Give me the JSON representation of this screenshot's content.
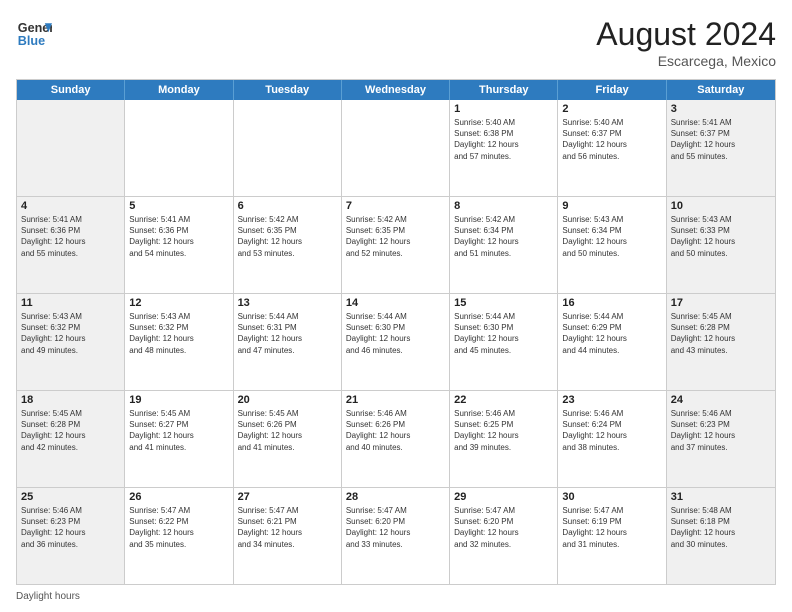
{
  "header": {
    "logo_line1": "General",
    "logo_line2": "Blue",
    "month_year": "August 2024",
    "location": "Escarcega, Mexico"
  },
  "days_of_week": [
    "Sunday",
    "Monday",
    "Tuesday",
    "Wednesday",
    "Thursday",
    "Friday",
    "Saturday"
  ],
  "weeks": [
    [
      {
        "day": "",
        "info": ""
      },
      {
        "day": "",
        "info": ""
      },
      {
        "day": "",
        "info": ""
      },
      {
        "day": "",
        "info": ""
      },
      {
        "day": "1",
        "info": "Sunrise: 5:40 AM\nSunset: 6:38 PM\nDaylight: 12 hours\nand 57 minutes."
      },
      {
        "day": "2",
        "info": "Sunrise: 5:40 AM\nSunset: 6:37 PM\nDaylight: 12 hours\nand 56 minutes."
      },
      {
        "day": "3",
        "info": "Sunrise: 5:41 AM\nSunset: 6:37 PM\nDaylight: 12 hours\nand 55 minutes."
      }
    ],
    [
      {
        "day": "4",
        "info": "Sunrise: 5:41 AM\nSunset: 6:36 PM\nDaylight: 12 hours\nand 55 minutes."
      },
      {
        "day": "5",
        "info": "Sunrise: 5:41 AM\nSunset: 6:36 PM\nDaylight: 12 hours\nand 54 minutes."
      },
      {
        "day": "6",
        "info": "Sunrise: 5:42 AM\nSunset: 6:35 PM\nDaylight: 12 hours\nand 53 minutes."
      },
      {
        "day": "7",
        "info": "Sunrise: 5:42 AM\nSunset: 6:35 PM\nDaylight: 12 hours\nand 52 minutes."
      },
      {
        "day": "8",
        "info": "Sunrise: 5:42 AM\nSunset: 6:34 PM\nDaylight: 12 hours\nand 51 minutes."
      },
      {
        "day": "9",
        "info": "Sunrise: 5:43 AM\nSunset: 6:34 PM\nDaylight: 12 hours\nand 50 minutes."
      },
      {
        "day": "10",
        "info": "Sunrise: 5:43 AM\nSunset: 6:33 PM\nDaylight: 12 hours\nand 50 minutes."
      }
    ],
    [
      {
        "day": "11",
        "info": "Sunrise: 5:43 AM\nSunset: 6:32 PM\nDaylight: 12 hours\nand 49 minutes."
      },
      {
        "day": "12",
        "info": "Sunrise: 5:43 AM\nSunset: 6:32 PM\nDaylight: 12 hours\nand 48 minutes."
      },
      {
        "day": "13",
        "info": "Sunrise: 5:44 AM\nSunset: 6:31 PM\nDaylight: 12 hours\nand 47 minutes."
      },
      {
        "day": "14",
        "info": "Sunrise: 5:44 AM\nSunset: 6:30 PM\nDaylight: 12 hours\nand 46 minutes."
      },
      {
        "day": "15",
        "info": "Sunrise: 5:44 AM\nSunset: 6:30 PM\nDaylight: 12 hours\nand 45 minutes."
      },
      {
        "day": "16",
        "info": "Sunrise: 5:44 AM\nSunset: 6:29 PM\nDaylight: 12 hours\nand 44 minutes."
      },
      {
        "day": "17",
        "info": "Sunrise: 5:45 AM\nSunset: 6:28 PM\nDaylight: 12 hours\nand 43 minutes."
      }
    ],
    [
      {
        "day": "18",
        "info": "Sunrise: 5:45 AM\nSunset: 6:28 PM\nDaylight: 12 hours\nand 42 minutes."
      },
      {
        "day": "19",
        "info": "Sunrise: 5:45 AM\nSunset: 6:27 PM\nDaylight: 12 hours\nand 41 minutes."
      },
      {
        "day": "20",
        "info": "Sunrise: 5:45 AM\nSunset: 6:26 PM\nDaylight: 12 hours\nand 41 minutes."
      },
      {
        "day": "21",
        "info": "Sunrise: 5:46 AM\nSunset: 6:26 PM\nDaylight: 12 hours\nand 40 minutes."
      },
      {
        "day": "22",
        "info": "Sunrise: 5:46 AM\nSunset: 6:25 PM\nDaylight: 12 hours\nand 39 minutes."
      },
      {
        "day": "23",
        "info": "Sunrise: 5:46 AM\nSunset: 6:24 PM\nDaylight: 12 hours\nand 38 minutes."
      },
      {
        "day": "24",
        "info": "Sunrise: 5:46 AM\nSunset: 6:23 PM\nDaylight: 12 hours\nand 37 minutes."
      }
    ],
    [
      {
        "day": "25",
        "info": "Sunrise: 5:46 AM\nSunset: 6:23 PM\nDaylight: 12 hours\nand 36 minutes."
      },
      {
        "day": "26",
        "info": "Sunrise: 5:47 AM\nSunset: 6:22 PM\nDaylight: 12 hours\nand 35 minutes."
      },
      {
        "day": "27",
        "info": "Sunrise: 5:47 AM\nSunset: 6:21 PM\nDaylight: 12 hours\nand 34 minutes."
      },
      {
        "day": "28",
        "info": "Sunrise: 5:47 AM\nSunset: 6:20 PM\nDaylight: 12 hours\nand 33 minutes."
      },
      {
        "day": "29",
        "info": "Sunrise: 5:47 AM\nSunset: 6:20 PM\nDaylight: 12 hours\nand 32 minutes."
      },
      {
        "day": "30",
        "info": "Sunrise: 5:47 AM\nSunset: 6:19 PM\nDaylight: 12 hours\nand 31 minutes."
      },
      {
        "day": "31",
        "info": "Sunrise: 5:48 AM\nSunset: 6:18 PM\nDaylight: 12 hours\nand 30 minutes."
      }
    ]
  ],
  "footer": {
    "label": "Daylight hours"
  }
}
